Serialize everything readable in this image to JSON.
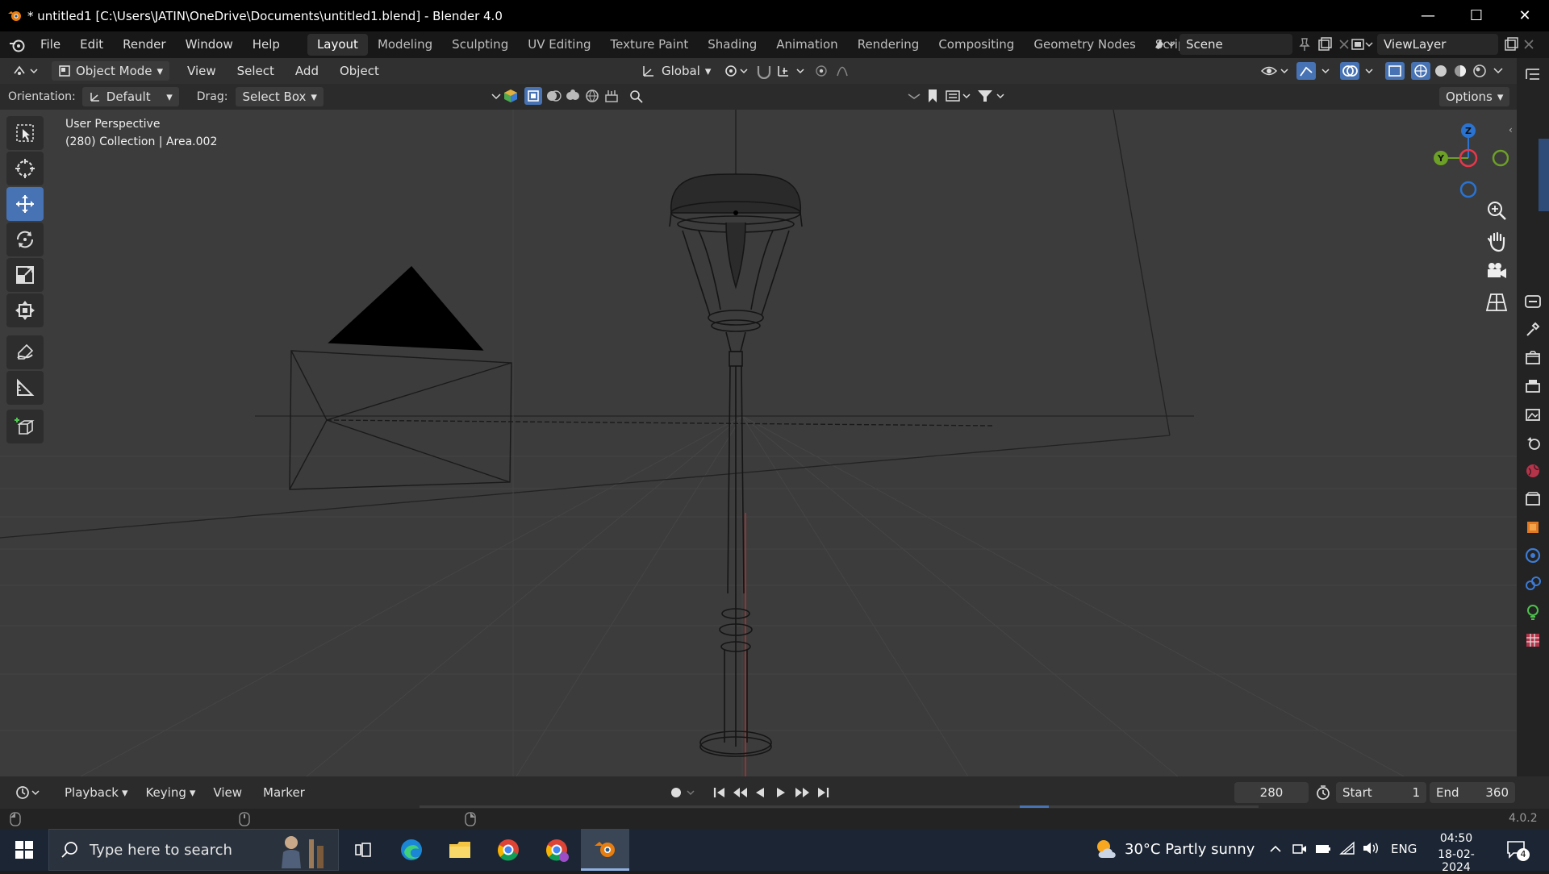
{
  "window": {
    "title": "* untitled1 [C:\\Users\\JATIN\\OneDrive\\Documents\\untitled1.blend] - Blender 4.0",
    "minimize_glyph": "—",
    "maximize_glyph": "☐",
    "close_glyph": "✕"
  },
  "menu": {
    "items": [
      "File",
      "Edit",
      "Render",
      "Window",
      "Help"
    ]
  },
  "workspaces": {
    "tabs": [
      "Layout",
      "Modeling",
      "Sculpting",
      "UV Editing",
      "Texture Paint",
      "Shading",
      "Animation",
      "Rendering",
      "Compositing",
      "Geometry Nodes",
      "Scripting"
    ],
    "active": "Layout",
    "add_glyph": "+"
  },
  "scene": {
    "label": "Scene"
  },
  "view_layer": {
    "label": "ViewLayer"
  },
  "viewport_header": {
    "mode": "Object Mode",
    "menus": [
      "View",
      "Select",
      "Add",
      "Object"
    ],
    "transform_orientation": "Global"
  },
  "tool_settings": {
    "orientation_label": "Orientation:",
    "orientation_value": "Default",
    "drag_label": "Drag:",
    "drag_value": "Select Box",
    "options_label": "Options",
    "search_placeholder": ""
  },
  "viewport": {
    "perspective": "User Perspective",
    "context": "(280) Collection | Area.002"
  },
  "gizmo": {
    "z_label": "Z",
    "y_label": "Y",
    "colors": {
      "x": "#e5384b",
      "y": "#6da026",
      "z": "#2a73d0"
    }
  },
  "timeline": {
    "menus": [
      "Playback",
      "Keying",
      "View",
      "Marker"
    ],
    "current_frame": "280",
    "start_label": "Start",
    "start_value": "1",
    "end_label": "End",
    "end_value": "360"
  },
  "statusbar": {
    "version": "4.0.2"
  },
  "taskbar": {
    "search_placeholder": "Type here to search",
    "weather": "30°C  Partly sunny",
    "language": "ENG",
    "time": "04:50",
    "date": "18-02-2024",
    "notification_count": "4"
  },
  "colors": {
    "accent": "#4772b3",
    "viewport_bg": "#3c3c3c",
    "header_bg": "#303030"
  }
}
